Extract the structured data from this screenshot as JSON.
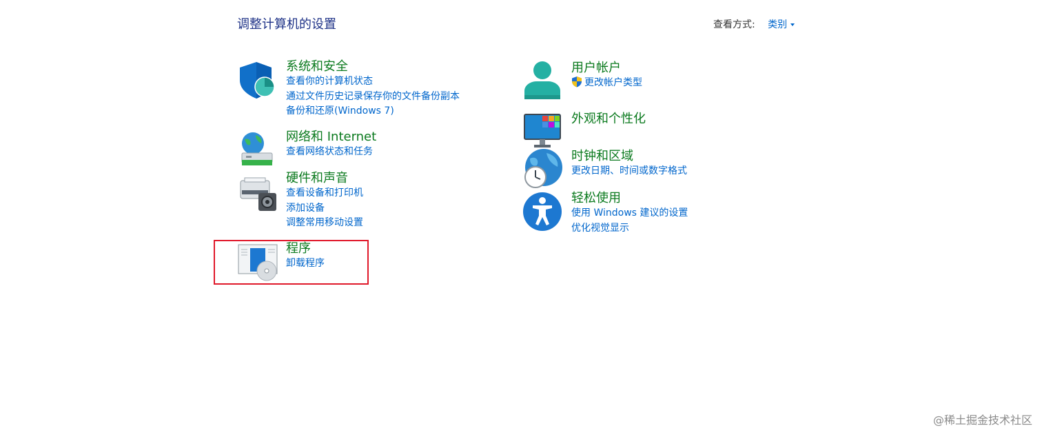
{
  "header": {
    "title": "调整计算机的设置",
    "view_by_label": "查看方式:",
    "view_by_value": "类别"
  },
  "categories": [
    {
      "id": "system-security",
      "title": "系统和安全",
      "icon": "shield-icon",
      "links": [
        "查看你的计算机状态",
        "通过文件历史记录保存你的文件备份副本",
        "备份和还原(Windows 7)"
      ]
    },
    {
      "id": "network-internet",
      "title": "网络和 Internet",
      "icon": "network-globe-icon",
      "links": [
        "查看网络状态和任务"
      ]
    },
    {
      "id": "hardware-sound",
      "title": "硬件和声音",
      "icon": "printer-icon",
      "links": [
        "查看设备和打印机",
        "添加设备",
        "调整常用移动设置"
      ]
    },
    {
      "id": "programs",
      "title": "程序",
      "icon": "programs-disc-icon",
      "links": [
        "卸载程序"
      ]
    },
    {
      "id": "user-accounts",
      "title": "用户帐户",
      "icon": "user-icon",
      "links": [
        "更改帐户类型"
      ]
    },
    {
      "id": "appearance",
      "title": "外观和个性化",
      "icon": "monitor-personalize-icon",
      "links": []
    },
    {
      "id": "clock-region",
      "title": "时钟和区域",
      "icon": "clock-globe-icon",
      "links": [
        "更改日期、时间或数字格式"
      ]
    },
    {
      "id": "ease-of-access",
      "title": "轻松使用",
      "icon": "accessibility-icon",
      "links": [
        "使用 Windows 建议的设置",
        "优化视觉显示"
      ]
    }
  ],
  "colors": {
    "title": "#1e3287",
    "category_title": "#0b7a1e",
    "link": "#0066cc",
    "highlight": "#e0182a"
  },
  "watermark": "@稀土掘金技术社区"
}
